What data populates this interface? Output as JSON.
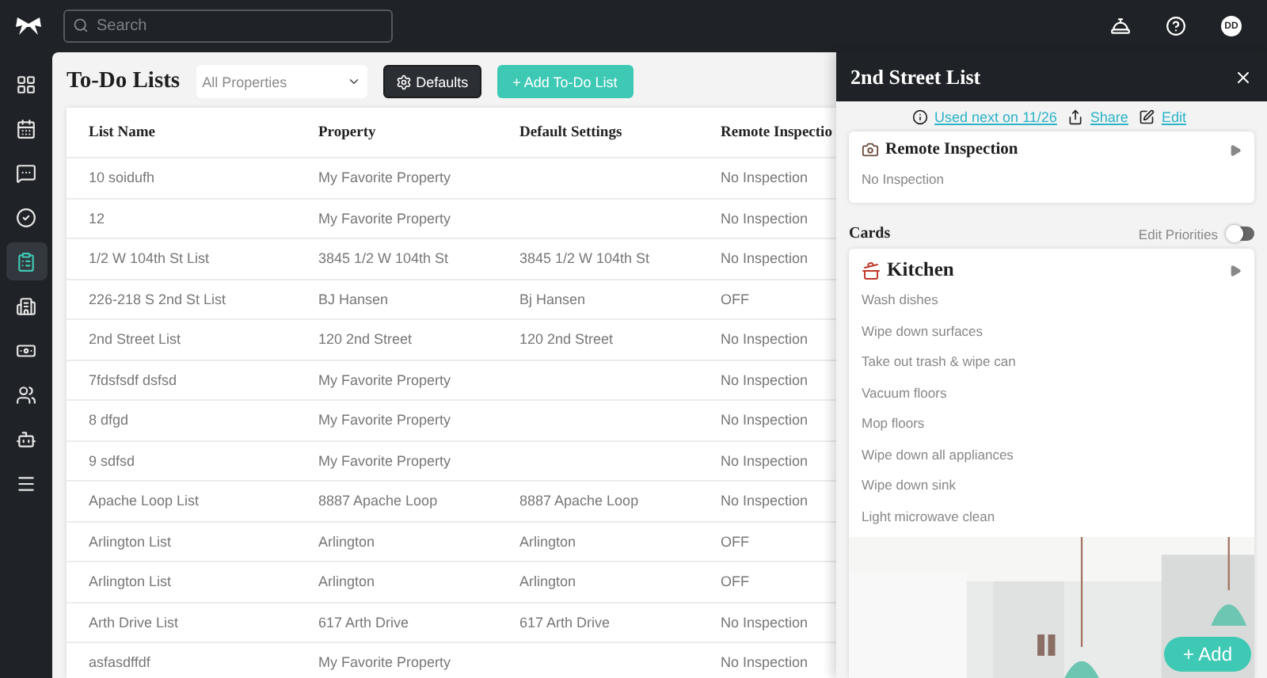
{
  "search": {
    "placeholder": "Search"
  },
  "user": {
    "initials": "DD"
  },
  "sidebar": {
    "items": [
      {
        "selected": false
      },
      {
        "selected": false
      },
      {
        "selected": false
      },
      {
        "selected": false
      },
      {
        "selected": true
      },
      {
        "selected": false
      },
      {
        "selected": false
      },
      {
        "selected": false
      },
      {
        "selected": false
      },
      {
        "selected": false
      }
    ]
  },
  "page": {
    "title": "To-Do Lists",
    "filter": {
      "value": "All Properties"
    },
    "defaults_button": "Defaults",
    "add_button": "+ Add To-Do List"
  },
  "table": {
    "columns": [
      "List Name",
      "Property",
      "Default Settings",
      "Remote Inspectio"
    ],
    "rows": [
      [
        "10 soidufh",
        "My Favorite Property",
        "",
        "No Inspection"
      ],
      [
        "12",
        "My Favorite Property",
        "",
        "No Inspection"
      ],
      [
        "1/2 W 104th St List",
        "3845 1/2 W 104th St",
        "3845 1/2 W 104th St",
        "No Inspection"
      ],
      [
        "226-218 S 2nd St List",
        "BJ Hansen",
        "Bj Hansen",
        "OFF"
      ],
      [
        "2nd Street List",
        "120 2nd Street",
        "120 2nd Street",
        "No Inspection"
      ],
      [
        "7fdsfsdf dsfsd",
        "My Favorite Property",
        "",
        "No Inspection"
      ],
      [
        "8 dfgd",
        "My Favorite Property",
        "",
        "No Inspection"
      ],
      [
        "9 sdfsd",
        "My Favorite Property",
        "",
        "No Inspection"
      ],
      [
        "Apache Loop List",
        "8887 Apache Loop",
        "8887 Apache Loop",
        "No Inspection"
      ],
      [
        "Arlington List",
        "Arlington",
        "Arlington",
        "OFF"
      ],
      [
        "Arlington List",
        "Arlington",
        "Arlington",
        "OFF"
      ],
      [
        "Arth Drive List",
        "617 Arth Drive",
        "617 Arth Drive",
        "No Inspection"
      ],
      [
        "asfasdffdf",
        "My Favorite Property",
        "",
        "No Inspection"
      ]
    ]
  },
  "panel": {
    "title": "2nd Street List",
    "used_next": "Used next on 11/26",
    "share": "Share",
    "edit": "Edit",
    "remote_inspection": {
      "title": "Remote Inspection",
      "value": "No Inspection"
    },
    "cards_heading": "Cards",
    "edit_priorities": {
      "label": "Edit Priorities",
      "on": false
    },
    "cards": [
      {
        "title": "Kitchen",
        "tasks": [
          "Wash dishes",
          "Wipe down surfaces",
          "Take out trash & wipe can",
          "Vacuum floors",
          "Mop floors",
          "Wipe down all appliances",
          "Wipe down sink",
          "Light microwave clean"
        ]
      }
    ],
    "add_button": "+ Add"
  }
}
